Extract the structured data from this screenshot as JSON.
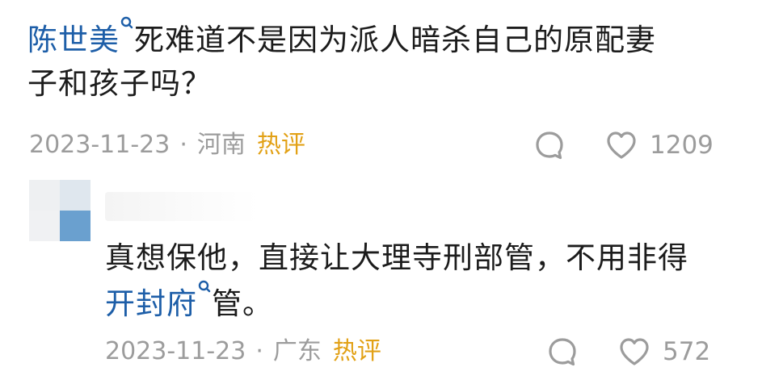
{
  "comments": [
    {
      "link_text": "陈世美",
      "text": "死难道不是因为派人暗杀自己的原配妻子和孩子吗？",
      "line1_rest": "死难道不是因为派人暗杀自己的原配妻",
      "line2": "子和孩子吗？",
      "date": "2023-11-23",
      "separator": "·",
      "location": "河南",
      "hot_label": "热评",
      "likes": "1209"
    },
    {
      "line1": "真想保他，直接让大理寺刑部管，不用非得",
      "link_text": "开封府",
      "line2_rest": "管。",
      "date": "2023-11-23",
      "separator": "·",
      "location": "广东",
      "hot_label": "热评",
      "likes": "572"
    }
  ],
  "icons": {
    "reply": "comment-bubble-icon",
    "like": "heart-icon",
    "search": "search-icon"
  },
  "colors": {
    "link": "#1d5ea8",
    "hot": "#e2a116",
    "meta": "#9c9c9c",
    "text": "#1c1c1c"
  }
}
